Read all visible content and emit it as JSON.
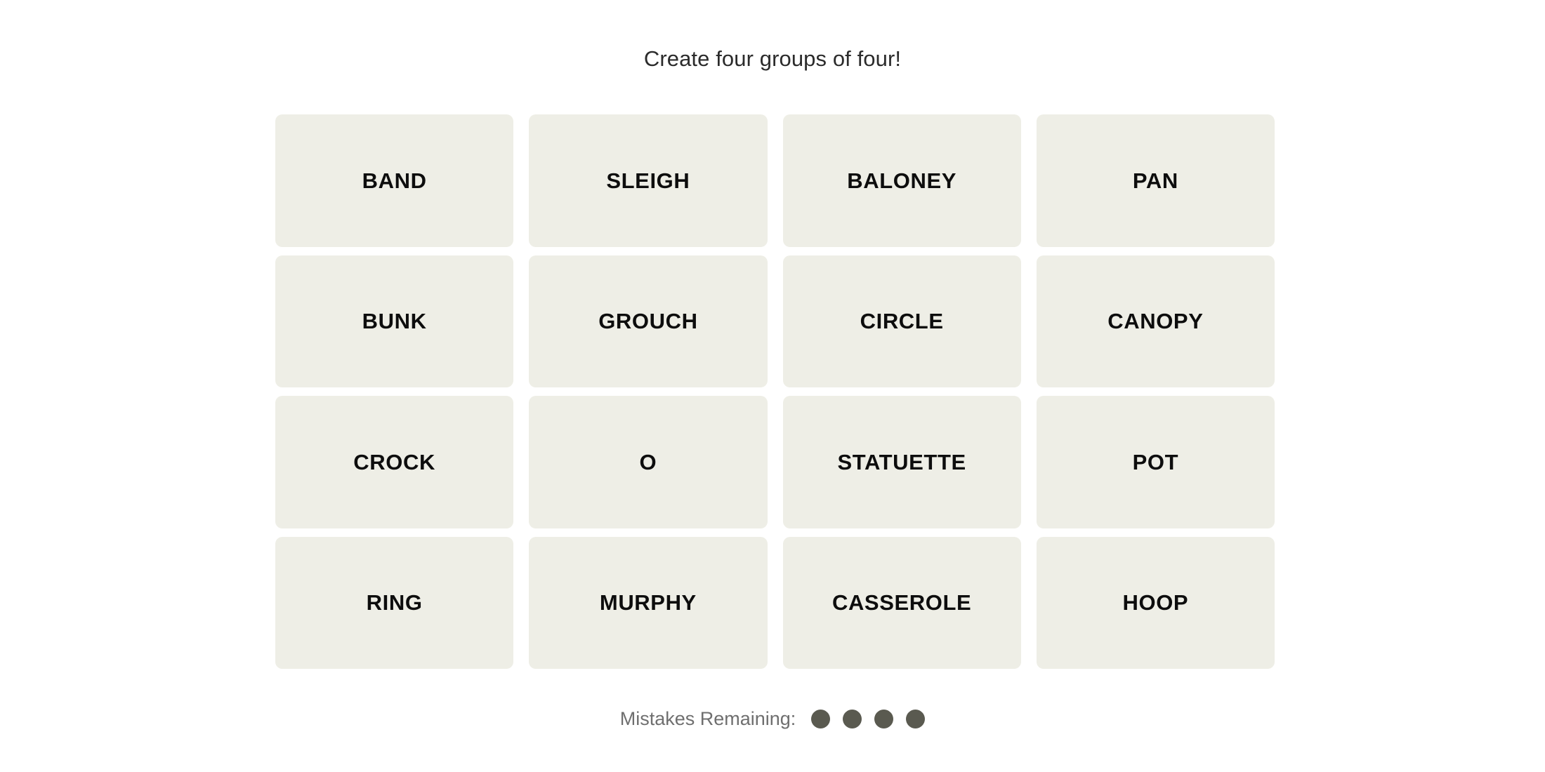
{
  "page": {
    "background_color": "#FFFFFF",
    "title": "Create four groups of four!"
  },
  "board": {
    "rows": 4,
    "columns": 4,
    "tile_color": "#EEEEE6",
    "tile_text_color": "#0D0D0D",
    "tiles": [
      {
        "label": "BAND"
      },
      {
        "label": "SLEIGH"
      },
      {
        "label": "BALONEY"
      },
      {
        "label": "PAN"
      },
      {
        "label": "BUNK"
      },
      {
        "label": "GROUCH"
      },
      {
        "label": "CIRCLE"
      },
      {
        "label": "CANOPY"
      },
      {
        "label": "CROCK"
      },
      {
        "label": "O"
      },
      {
        "label": "STATUETTE"
      },
      {
        "label": "POT"
      },
      {
        "label": "RING"
      },
      {
        "label": "MURPHY"
      },
      {
        "label": "CASSEROLE"
      },
      {
        "label": "HOOP"
      }
    ]
  },
  "footer": {
    "mistakes_label": "Mistakes Remaining:",
    "mistakes_remaining": 4,
    "dot_color": "#5A5A50",
    "label_color": "#6F6F6F",
    "dots": [
      {
        "name": "mistake-dot-1"
      },
      {
        "name": "mistake-dot-2"
      },
      {
        "name": "mistake-dot-3"
      },
      {
        "name": "mistake-dot-4"
      }
    ]
  }
}
